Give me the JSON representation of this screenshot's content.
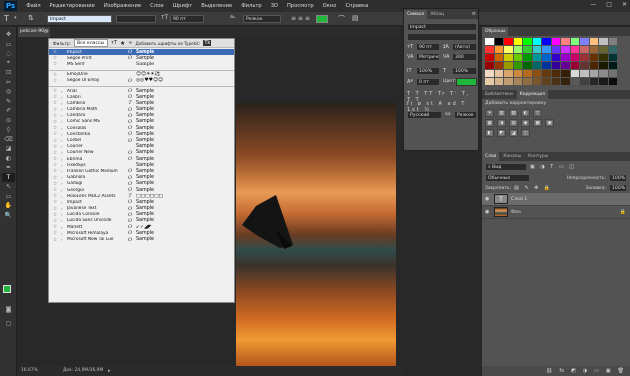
{
  "app": {
    "logo": "Ps"
  },
  "menu": [
    "Файл",
    "Редактирование",
    "Изображение",
    "Слои",
    "Шрифт",
    "Выделение",
    "Фильтр",
    "3D",
    "Просмотр",
    "Окно",
    "Справка"
  ],
  "window_controls": [
    "—",
    "□",
    "✕"
  ],
  "options": {
    "font_family": "Impact",
    "font_size": "90 пт",
    "anti_alias": "Резкое",
    "text_color": "#1fb83a"
  },
  "document": {
    "tab_label": "pelican-90@",
    "zoom": "16.67%",
    "doc_info": "Док: 24,9M/36,9M"
  },
  "font_list": {
    "header": {
      "filter_label": "Фильтр:",
      "filter_value": "Все классы",
      "typekit_label": "Добавить шрифты из Typekit:"
    },
    "group1": [
      {
        "name": "Impact",
        "type": "O",
        "sample": "Sample"
      },
      {
        "name": "Segoe Print",
        "type": "O",
        "sample": "Sample"
      },
      {
        "name": "MS Serif",
        "type": "",
        "sample": "Sample"
      }
    ],
    "group2": [
      {
        "name": "EmojiOne",
        "type": "",
        "sample": "😊😊☀☀⚽"
      },
      {
        "name": "Segoe UI Emoji",
        "type": "O",
        "sample": "◎◎♥♥☺☺"
      }
    ],
    "group3": [
      {
        "name": "Arial",
        "type": "O",
        "sample": "Sample"
      },
      {
        "name": "Calibri",
        "type": "O",
        "sample": "Sample"
      },
      {
        "name": "Cambria",
        "type": "T",
        "sample": "Sample"
      },
      {
        "name": "Cambria Math",
        "type": "O",
        "sample": "Sample"
      },
      {
        "name": "Candara",
        "type": "O",
        "sample": "Sample"
      },
      {
        "name": "Comic Sans MS",
        "type": "O",
        "sample": "Sample"
      },
      {
        "name": "Consolas",
        "type": "O",
        "sample": "Sample"
      },
      {
        "name": "Constantia",
        "type": "O",
        "sample": "Sample"
      },
      {
        "name": "Corbel",
        "type": "O",
        "sample": "Sample"
      },
      {
        "name": "Courier",
        "type": "",
        "sample": "Sample"
      },
      {
        "name": "Courier New",
        "type": "O",
        "sample": "Sample"
      },
      {
        "name": "Ebrima",
        "type": "O",
        "sample": "Sample"
      },
      {
        "name": "FixedSys",
        "type": "",
        "sample": "Sample"
      },
      {
        "name": "Franklin Gothic Medium",
        "type": "O",
        "sample": "Sample"
      },
      {
        "name": "Gabriola",
        "type": "O",
        "sample": "Sample"
      },
      {
        "name": "Gadugi",
        "type": "O",
        "sample": "Sample"
      },
      {
        "name": "Georgia",
        "type": "O",
        "sample": "Sample"
      },
      {
        "name": "HoloLens MDL2 Assets",
        "type": "T",
        "sample": "□□□□□□"
      },
      {
        "name": "Impact",
        "type": "O",
        "sample": "Sample"
      },
      {
        "name": "Javanese Text",
        "type": "O",
        "sample": "Sample"
      },
      {
        "name": "Lucida Console",
        "type": "O",
        "sample": "Sample"
      },
      {
        "name": "Lucida Sans Unicode",
        "type": "O",
        "sample": "Sample"
      },
      {
        "name": "Marlett",
        "type": "O",
        "sample": "↙✓◢◤"
      },
      {
        "name": "Microsoft Himalaya",
        "type": "O",
        "sample": "Sample"
      },
      {
        "name": "Microsoft New Tai Lue",
        "type": "O",
        "sample": "Sample"
      }
    ]
  },
  "char_panel": {
    "tabs": [
      "Символ",
      "Абзац"
    ],
    "font_family": "Impact",
    "font_size": "90 пт",
    "leading": "(Авто)",
    "kerning": "Метрически",
    "tracking": "300",
    "vert_scale": "100%",
    "horiz_scale": "100%",
    "baseline": "0 пт",
    "color_label": "Цвет:",
    "color": "#1fb83a",
    "language": "Русский",
    "anti_alias": "Резкое"
  },
  "swatches": {
    "tab": "Образцы",
    "colors": [
      "#ffffff",
      "#000000",
      "#ff0000",
      "#ffff00",
      "#00ff00",
      "#00ffff",
      "#0000ff",
      "#ff00ff",
      "#ff8080",
      "#80ff80",
      "#8080ff",
      "#ffc080",
      "#c0c0c0",
      "#808080",
      "#ff3333",
      "#ff9933",
      "#ffff66",
      "#99ff66",
      "#33cc33",
      "#33cccc",
      "#3399ff",
      "#6633ff",
      "#cc33ff",
      "#ff3399",
      "#cc6666",
      "#996633",
      "#666633",
      "#336666",
      "#cc0000",
      "#cc6600",
      "#cccc00",
      "#66cc00",
      "#009900",
      "#009999",
      "#0066cc",
      "#3300cc",
      "#9900cc",
      "#cc0066",
      "#993333",
      "#663300",
      "#333300",
      "#003333",
      "#990000",
      "#993300",
      "#999900",
      "#339900",
      "#006600",
      "#006666",
      "#003399",
      "#330099",
      "#660099",
      "#990033",
      "#663333",
      "#4d2600",
      "#1a1a00",
      "#001a1a",
      "#f2d9c6",
      "#e6c3a0",
      "#d9a66c",
      "#cc8b3c",
      "#b36b1e",
      "#8c4f14",
      "#663a0f",
      "#4d2b0a",
      "#332007",
      "#d9d9d9",
      "#bfbfbf",
      "#a6a6a6",
      "#8c8c8c",
      "#737373",
      "#e8c9a8",
      "#d4b48c",
      "#c09c70",
      "#a88458",
      "#906c42",
      "#78562e",
      "#60421e",
      "#4a3014",
      "#35220c",
      "#595959",
      "#404040",
      "#262626",
      "#1a1a1a",
      "#0d0d0d"
    ]
  },
  "adjustments": {
    "tabs": [
      "Библиотеки",
      "Коррекция"
    ],
    "label": "Добавить корректировку",
    "row1": [
      "☀",
      "▥",
      "▨",
      "◐",
      "▽"
    ],
    "row2": [
      "▦",
      "◑",
      "▤",
      "◉",
      "▩",
      "▣"
    ],
    "row3": [
      "◧",
      "◩",
      "◪",
      "◫"
    ]
  },
  "layers": {
    "tabs": [
      "Слои",
      "Каналы",
      "Контуры"
    ],
    "filter_label": "Вид",
    "blend_mode": "Обычные",
    "opacity_label": "Непрозрачность:",
    "opacity": "100%",
    "lock_label": "Закрепить:",
    "fill_label": "Заливка:",
    "fill": "100%",
    "items": [
      {
        "name": "Слой 1",
        "kind": "text"
      },
      {
        "name": "Фон",
        "kind": "image"
      }
    ],
    "footer_icons": [
      "⛓",
      "fx",
      "◩",
      "◑",
      "▭",
      "▣",
      "🗑"
    ]
  },
  "tools": [
    "✥",
    "▭",
    "◌",
    "⌖",
    "⊡",
    "✂",
    "◎",
    "✎",
    "✐",
    "⊙",
    "◊",
    "⌫",
    "◪",
    "◐",
    "✒",
    "T",
    "↖",
    "▭",
    "✋",
    "🔍"
  ]
}
